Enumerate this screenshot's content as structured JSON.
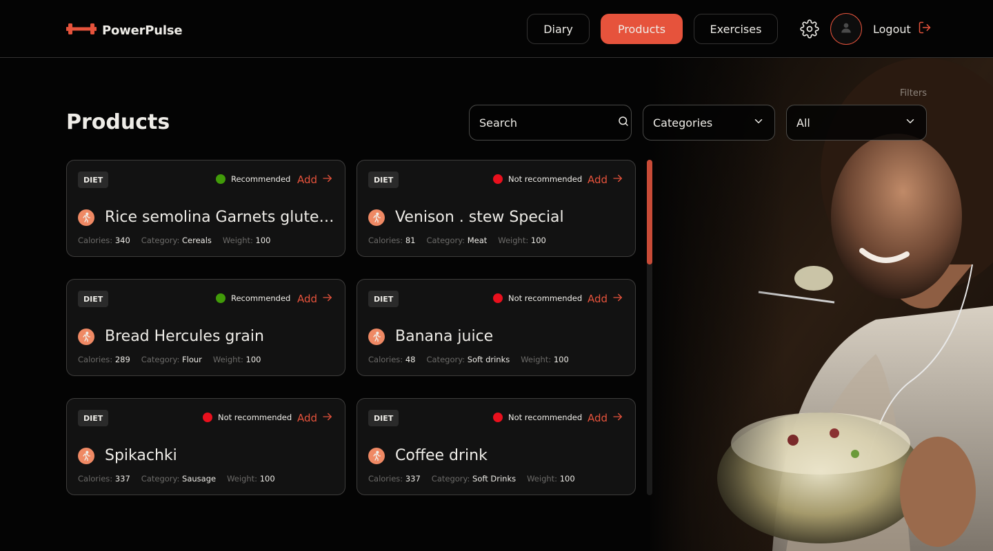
{
  "header": {
    "logo_text": "PowerPulse",
    "nav": [
      {
        "label": "Diary",
        "active": false
      },
      {
        "label": "Products",
        "active": true
      },
      {
        "label": "Exercises",
        "active": false
      }
    ],
    "logout_label": "Logout"
  },
  "page": {
    "title": "Products",
    "filters_label": "Filters",
    "search_placeholder": "Search",
    "categories_value": "Categories",
    "recommendation_value": "All"
  },
  "products": [
    {
      "badge": "DIET",
      "status": "Recommended",
      "status_color": "#419B09",
      "add_label": "Add",
      "title": "Rice semolina Garnets gluten-free",
      "calories_label": "Calories:",
      "calories": "340",
      "category_label": "Category:",
      "category": "Cereals",
      "weight_label": "Weight:",
      "weight": "100"
    },
    {
      "badge": "DIET",
      "status": "Not recommended",
      "status_color": "#E9101D",
      "add_label": "Add",
      "title": "Venison . stew Special",
      "calories_label": "Calories:",
      "calories": "81",
      "category_label": "Category:",
      "category": "Meat",
      "weight_label": "Weight:",
      "weight": "100"
    },
    {
      "badge": "DIET",
      "status": "Recommended",
      "status_color": "#419B09",
      "add_label": "Add",
      "title": "Bread Hercules grain",
      "calories_label": "Calories:",
      "calories": "289",
      "category_label": "Category:",
      "category": "Flour",
      "weight_label": "Weight:",
      "weight": "100"
    },
    {
      "badge": "DIET",
      "status": "Not recommended",
      "status_color": "#E9101D",
      "add_label": "Add",
      "title": "Banana juice",
      "calories_label": "Calories:",
      "calories": "48",
      "category_label": "Category:",
      "category": "Soft drinks",
      "weight_label": "Weight:",
      "weight": "100"
    },
    {
      "badge": "DIET",
      "status": "Not recommended",
      "status_color": "#E9101D",
      "add_label": "Add",
      "title": "Spikachki",
      "calories_label": "Calories:",
      "calories": "337",
      "category_label": "Category:",
      "category": "Sausage",
      "weight_label": "Weight:",
      "weight": "100"
    },
    {
      "badge": "DIET",
      "status": "Not recommended",
      "status_color": "#E9101D",
      "add_label": "Add",
      "title": "Coffee drink",
      "calories_label": "Calories:",
      "calories": "337",
      "category_label": "Category:",
      "category": "Soft Drinks",
      "weight_label": "Weight:",
      "weight": "100"
    }
  ],
  "colors": {
    "accent": "#E6533C",
    "recommended": "#419B09",
    "not_recommended": "#E9101D",
    "background": "#040404"
  },
  "icons": [
    "dumbbell-icon",
    "gear-icon",
    "user-icon",
    "logout-icon",
    "search-icon",
    "chevron-down-icon",
    "arrow-right-icon",
    "runner-icon"
  ]
}
